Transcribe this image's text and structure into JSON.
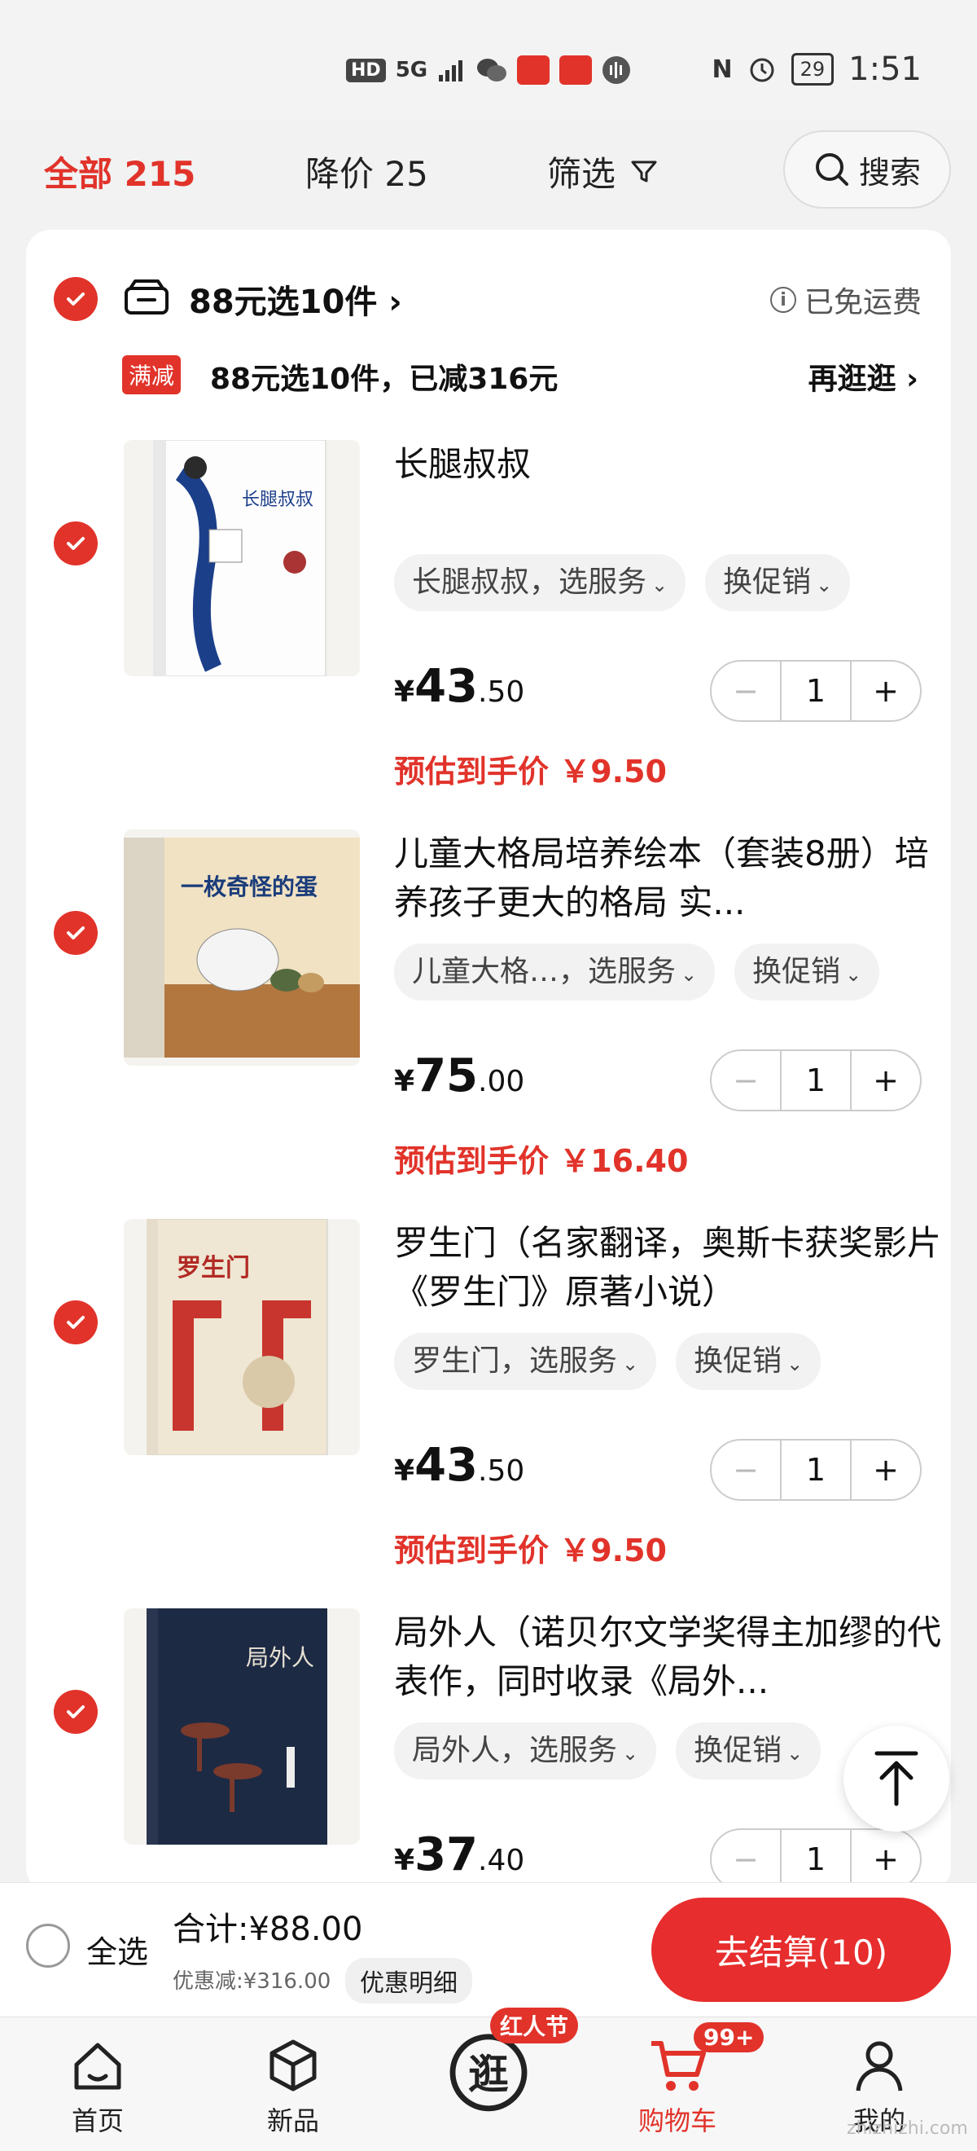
{
  "status_bar": {
    "left_icons": [
      "HD",
      "5G"
    ],
    "time": "1:51",
    "battery": "29"
  },
  "filter_bar": {
    "all_label": "全部 215",
    "price_drop_label": "降价 25",
    "filter_label": "筛选",
    "search_label": "搜索"
  },
  "shop": {
    "name": "88元选10件",
    "shipping": "已免运费",
    "promo_tag": "满减",
    "promo_text": "88元选10件，已减316元",
    "promo_more": "再逛逛"
  },
  "items": [
    {
      "title": "长腿叔叔",
      "service_chip": "长腿叔叔，选服务",
      "promo_chip": "换促销",
      "price_int": "43",
      "price_dec": ".50",
      "qty": "1",
      "estimate": "预估到手价 ￥9.50",
      "cover_text": "长腿叔叔"
    },
    {
      "title": "儿童大格局培养绘本（套装8册）培养孩子更大的格局 实...",
      "service_chip": "儿童大格…，选服务",
      "promo_chip": "换促销",
      "price_int": "75",
      "price_dec": ".00",
      "qty": "1",
      "estimate": "预估到手价 ￥16.40",
      "cover_text": "一枚奇怪的蛋"
    },
    {
      "title": "罗生门（名家翻译，奥斯卡获奖影片《罗生门》原著小说）",
      "service_chip": "罗生门，选服务",
      "promo_chip": "换促销",
      "price_int": "43",
      "price_dec": ".50",
      "qty": "1",
      "estimate": "预估到手价 ￥9.50",
      "cover_text": "罗生门"
    },
    {
      "title": "局外人（诺贝尔文学奖得主加缪的代表作，同时收录《局外...",
      "service_chip": "局外人，选服务",
      "promo_chip": "换促销",
      "price_int": "37",
      "price_dec": ".40",
      "qty": "1",
      "estimate": "",
      "cover_text": "局外人"
    }
  ],
  "currency": "¥",
  "stepper": {
    "minus": "−",
    "plus": "+"
  },
  "checkout": {
    "select_all": "全选",
    "total": "合计:¥88.00",
    "discount": "优惠减:¥316.00",
    "discount_detail": "优惠明细",
    "button": "去结算(10)"
  },
  "tabs": [
    {
      "label": "首页",
      "icon": "home-icon"
    },
    {
      "label": "新品",
      "icon": "box-icon"
    },
    {
      "label": "",
      "icon": "stroll-icon",
      "badge": "红人节"
    },
    {
      "label": "购物车",
      "icon": "cart-icon",
      "badge": "99+"
    },
    {
      "label": "我的",
      "icon": "user-icon"
    }
  ],
  "stroll_glyph": "逛",
  "watermark": "zhizhizhi.com",
  "colors": {
    "accent": "#e1332a",
    "background": "#f2f2f2"
  }
}
